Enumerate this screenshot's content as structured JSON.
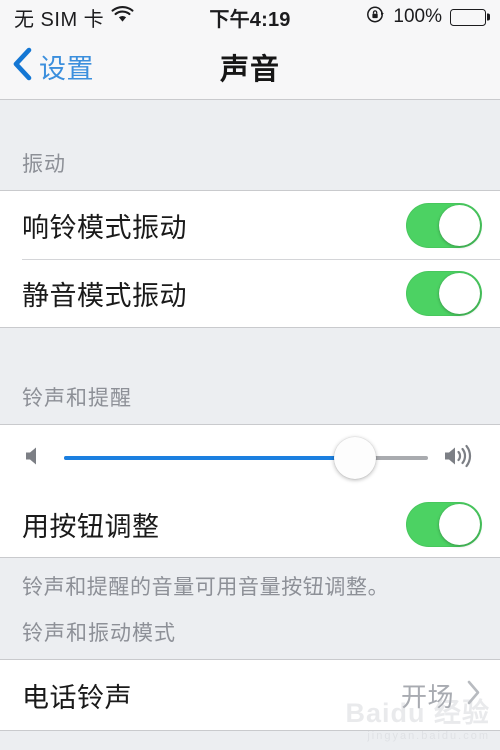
{
  "status_bar": {
    "carrier": "无 SIM 卡",
    "wifi_icon": "wifi-icon",
    "time": "下午4:19",
    "rotation_lock_icon": "rotation-lock-icon",
    "battery_percent": "100%",
    "battery_level": 100,
    "battery_icon": "battery-full-icon"
  },
  "nav": {
    "back_icon": "chevron-left-icon",
    "back_label": "设置",
    "title": "声音"
  },
  "sections": [
    {
      "header": "振动",
      "rows": [
        {
          "label": "响铃模式振动",
          "type": "toggle",
          "value": "on"
        },
        {
          "label": "静音模式振动",
          "type": "toggle",
          "value": "on"
        }
      ],
      "footer": ""
    },
    {
      "header": "铃声和提醒",
      "rows": [
        {
          "label": "",
          "type": "slider",
          "value": 80,
          "left_icon": "speaker-low-icon",
          "right_icon": "speaker-high-icon"
        },
        {
          "label": "用按钮调整",
          "type": "toggle",
          "value": "on"
        }
      ],
      "footer": "铃声和提醒的音量可用音量按钮调整。"
    },
    {
      "header": "铃声和振动模式",
      "rows": [
        {
          "label": "电话铃声",
          "type": "disclosure",
          "value": "开场",
          "chevron_icon": "chevron-right-icon"
        }
      ],
      "footer": ""
    }
  ],
  "watermark": {
    "main": "Baidu 经验",
    "sub": "jingyan.baidu.com"
  },
  "colors": {
    "accent_blue": "#3b8fdd",
    "slider_blue": "#1b7fe0",
    "toggle_green": "#4cd263",
    "group_bg": "#eceef1",
    "cell_bg": "#ffffff",
    "secondary_text": "#8d9097"
  }
}
